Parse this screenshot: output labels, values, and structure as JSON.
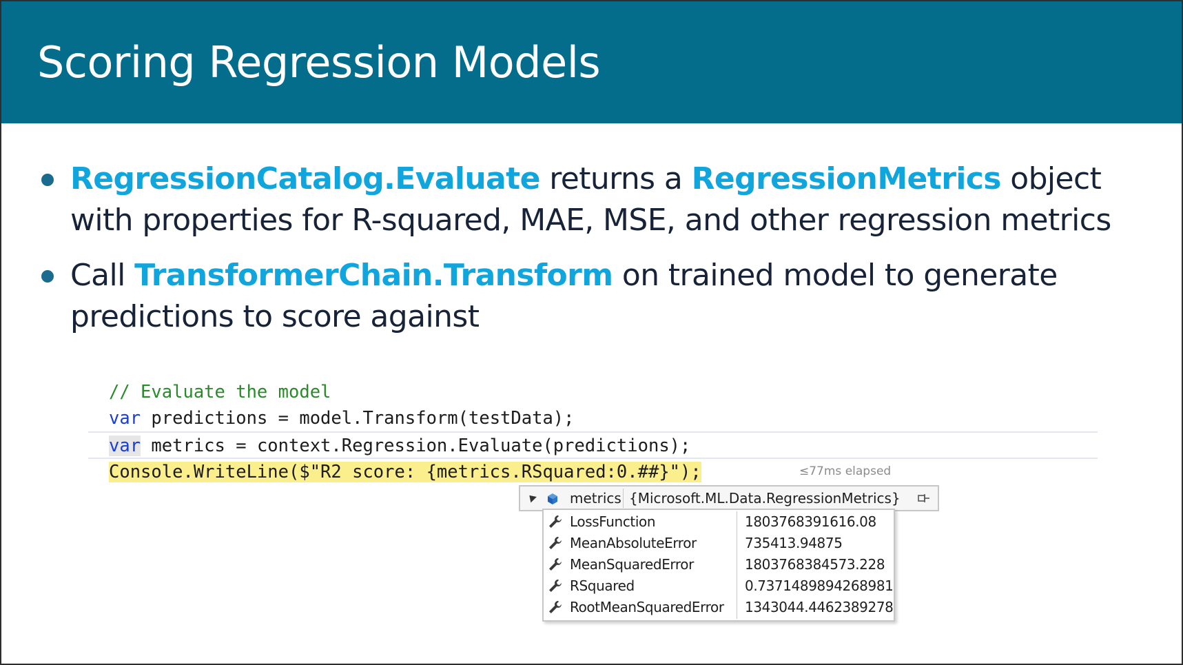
{
  "slide": {
    "title": "Scoring Regression Models",
    "colors": {
      "title_bar": "#036d8b",
      "keyword": "#10a5dd",
      "body_text": "#172338"
    }
  },
  "bullets": [
    {
      "kw1": "RegressionCatalog.Evaluate",
      "t1": " returns a ",
      "kw2": "RegressionMetrics",
      "t2": " object with properties for R-squared, MAE, MSE, and other regression metrics"
    },
    {
      "t0": "Call ",
      "kw1": "TransformerChain.Transform",
      "t1": " on trained model to generate predictions to score against"
    }
  ],
  "code": {
    "comment": "// Evaluate the model",
    "line2_kw": "var",
    "line2_rest": " predictions = model.Transform(testData);",
    "line3_kw": "var",
    "line3_rest": " metrics = context.Regression.Evaluate(predictions);",
    "line4": "Console.WriteLine($\"R2 score: {metrics.RSquared:0.##}\");",
    "elapsed": "≤77ms elapsed"
  },
  "datatip": {
    "name": "metrics",
    "type": "{Microsoft.ML.Data.RegressionMetrics}",
    "rows": [
      {
        "name": "LossFunction",
        "value": "1803768391616.08"
      },
      {
        "name": "MeanAbsoluteError",
        "value": "735413.94875"
      },
      {
        "name": "MeanSquaredError",
        "value": "1803768384573.228"
      },
      {
        "name": "RSquared",
        "value": "0.7371489894268981"
      },
      {
        "name": "RootMeanSquaredError",
        "value": "1343044.4462389278"
      }
    ]
  }
}
